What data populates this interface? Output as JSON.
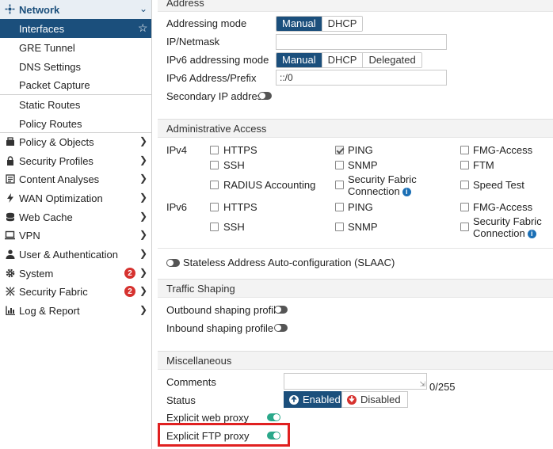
{
  "sidebar": {
    "items": [
      {
        "label": "Network",
        "icon": "network-icon"
      },
      {
        "label": "Interfaces",
        "icon": "star-icon"
      },
      {
        "label": "GRE Tunnel"
      },
      {
        "label": "DNS Settings"
      },
      {
        "label": "Packet Capture"
      },
      {
        "label": "Static Routes"
      },
      {
        "label": "Policy Routes"
      },
      {
        "label": "Policy & Objects",
        "icon": "policy-icon"
      },
      {
        "label": "Security Profiles",
        "icon": "lock-icon"
      },
      {
        "label": "Content Analyses",
        "icon": "content-icon"
      },
      {
        "label": "WAN Optimization",
        "icon": "bolt-icon"
      },
      {
        "label": "Web Cache",
        "icon": "database-icon"
      },
      {
        "label": "VPN",
        "icon": "monitor-icon"
      },
      {
        "label": "User & Authentication",
        "icon": "user-icon"
      },
      {
        "label": "System",
        "icon": "gear-icon",
        "badge": "2"
      },
      {
        "label": "Security Fabric",
        "icon": "fabric-icon",
        "badge": "2"
      },
      {
        "label": "Log & Report",
        "icon": "chart-icon"
      }
    ]
  },
  "address": {
    "header": "Address",
    "mode_label": "Addressing mode",
    "mode_opts": [
      "Manual",
      "DHCP"
    ],
    "ipmask_label": "IP/Netmask",
    "ipmask_value": "",
    "v6mode_label": "IPv6 addressing mode",
    "v6mode_opts": [
      "Manual",
      "DHCP",
      "Delegated"
    ],
    "v6prefix_label": "IPv6 Address/Prefix",
    "v6prefix_value": "::/0",
    "secondary_label": "Secondary IP address"
  },
  "admin": {
    "header": "Administrative Access",
    "ipv4_label": "IPv4",
    "ipv6_label": "IPv6",
    "ipv4": {
      "https": "HTTPS",
      "ping": "PING",
      "fmg": "FMG-Access",
      "ssh": "SSH",
      "snmp": "SNMP",
      "ftm": "FTM",
      "radius": "RADIUS Accounting",
      "fabric1": "Security Fabric",
      "fabric2": "Connection",
      "speed": "Speed Test"
    },
    "ipv6": {
      "https": "HTTPS",
      "ping": "PING",
      "fmg": "FMG-Access",
      "ssh": "SSH",
      "snmp": "SNMP",
      "fabric1": "Security Fabric",
      "fabric2": "Connection"
    },
    "info_glyph": "i"
  },
  "slaac_label": "Stateless Address Auto-configuration (SLAAC)",
  "shaping": {
    "header": "Traffic Shaping",
    "outbound": "Outbound shaping profile",
    "inbound": "Inbound shaping profile"
  },
  "misc": {
    "header": "Miscellaneous",
    "comments_label": "Comments",
    "comments_count": "0/255",
    "status_label": "Status",
    "enabled": "Enabled",
    "disabled": "Disabled",
    "web_proxy": "Explicit web proxy",
    "ftp_proxy": "Explicit FTP proxy"
  },
  "colors": {
    "accent": "#1b4f7c",
    "toggle_on": "#2aa88a",
    "badge": "#d6322f",
    "highlight": "#e02020"
  }
}
